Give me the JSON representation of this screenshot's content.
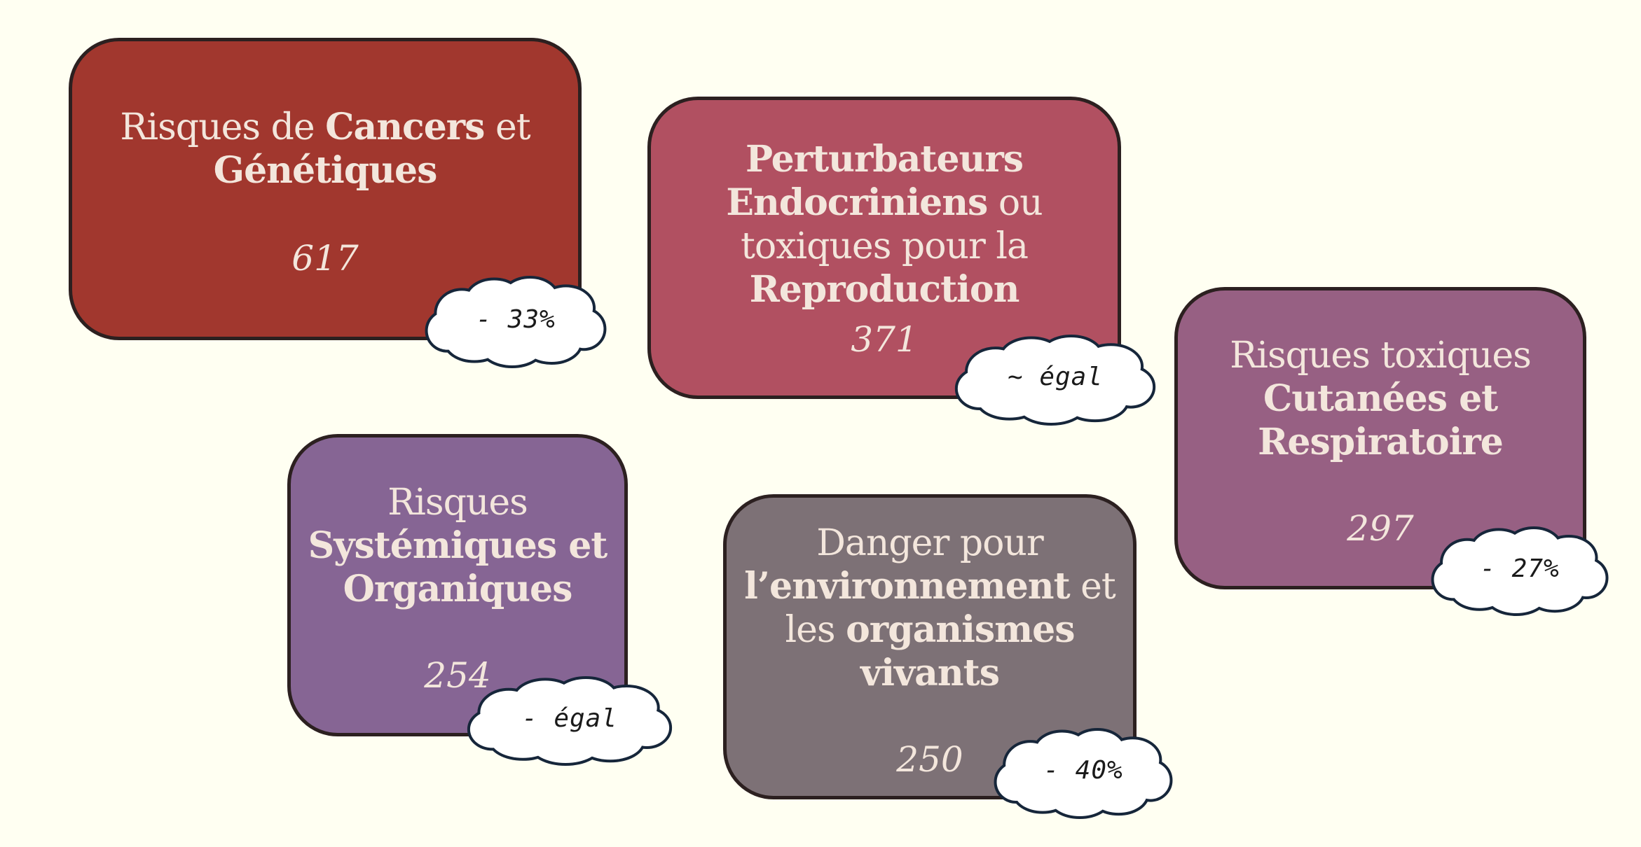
{
  "background_color": "#fffff2",
  "cards": [
    {
      "id": "cancers",
      "title_parts": [
        {
          "text": "Risques de ",
          "bold": false
        },
        {
          "text": "Cancers",
          "bold": true
        },
        {
          "text": " et ",
          "bold": false
        },
        {
          "text": "Génétiques",
          "bold": true
        }
      ],
      "count": "617",
      "change": "- 33%",
      "color": "#a1372e"
    },
    {
      "id": "endocrine",
      "title_parts": [
        {
          "text": "Perturbateurs Endocriniens",
          "bold": true
        },
        {
          "text": " ou toxiques pour la ",
          "bold": false
        },
        {
          "text": "Reproduction",
          "bold": true
        }
      ],
      "count": "371",
      "change": "~ égal",
      "color": "#b15061"
    },
    {
      "id": "cutaneous",
      "title_parts": [
        {
          "text": "Risques toxiques ",
          "bold": false
        },
        {
          "text": "Cutanées et Respiratoire",
          "bold": true
        }
      ],
      "count": "297",
      "change": "- 27%",
      "color": "#976083"
    },
    {
      "id": "systemic",
      "title_parts": [
        {
          "text": "Risques ",
          "bold": false
        },
        {
          "text": "Systémiques et Organiques",
          "bold": true
        }
      ],
      "count": "254",
      "change": "- égal",
      "color": "#866594"
    },
    {
      "id": "environment",
      "title_parts": [
        {
          "text": "Danger pour ",
          "bold": false
        },
        {
          "text": "l’environnement",
          "bold": true
        },
        {
          "text": " et les ",
          "bold": false
        },
        {
          "text": "organismes vivants",
          "bold": true
        }
      ],
      "count": "250",
      "change": "- 40%",
      "color": "#7d7176"
    }
  ]
}
